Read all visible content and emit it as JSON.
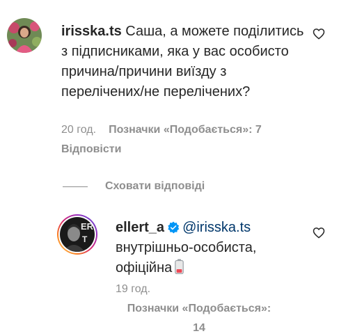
{
  "comment": {
    "username": "irisska.ts",
    "text": " Саша, а можете поділитись з підписниками, яка у вас особисто причина/причини виїзду з перелічених/не перелічених?",
    "time": "20 год.",
    "likes": "Позначки «Подобається»: 7",
    "reply_label": "Відповісти"
  },
  "hide_replies_label": "Сховати відповіді",
  "reply": {
    "username": "ellert_a",
    "mention": "@irisska.ts",
    "text_line1": "внутрішньо-особиста,",
    "text_line2": "офіційна",
    "time": "19 год.",
    "likes_line1": "Позначки «Подобається»:",
    "likes_line2": "14"
  },
  "colors": {
    "text": "#262626",
    "secondary": "#8e8e8e",
    "mention": "#00376b",
    "verified": "#0095f6",
    "battery": "#ed4956"
  },
  "icons": [
    "heart-outline-icon",
    "verified-badge-icon",
    "low-battery-emoji-icon"
  ]
}
